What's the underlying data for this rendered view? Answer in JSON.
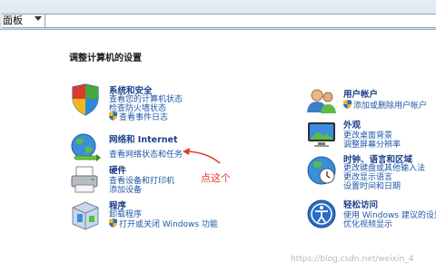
{
  "address_bar": {
    "crumb": "面板"
  },
  "page_title": "调整计算机的设置",
  "categories_left": [
    {
      "heading": "系统和安全",
      "links": [
        "查看您的计算机状态",
        "检查防火墙状态",
        "查看事件日志"
      ]
    },
    {
      "heading": "网络和 Internet",
      "links": [
        "查看网络状态和任务"
      ]
    },
    {
      "heading": "硬件",
      "links": [
        "查看设备和打印机",
        "添加设备"
      ]
    },
    {
      "heading": "程序",
      "links": [
        "卸载程序",
        "打开或关闭 Windows 功能"
      ]
    }
  ],
  "categories_right": [
    {
      "heading": "用户帐户",
      "links": [
        "添加或删除用户帐户"
      ]
    },
    {
      "heading": "外观",
      "links": [
        "更改桌面背景",
        "调整屏幕分辨率"
      ]
    },
    {
      "heading": "时钟、语言和区域",
      "links": [
        "更改键盘或其他输入法",
        "更改显示语言",
        "设置时间和日期"
      ]
    },
    {
      "heading": "轻松访问",
      "links": [
        "使用 Windows 建议的设置",
        "优化视频显示"
      ]
    }
  ],
  "annotation": {
    "text": "点这个",
    "color": "#e0392b"
  },
  "watermark": "https://blog.csdn.net/weixin_4",
  "icons": [
    "system-security-icon",
    "network-globe-icon",
    "hardware-printer-icon",
    "programs-box-icon",
    "user-accounts-icon",
    "appearance-monitor-icon",
    "clock-globe-icon",
    "ease-of-access-icon",
    "uac-shield-icon"
  ]
}
